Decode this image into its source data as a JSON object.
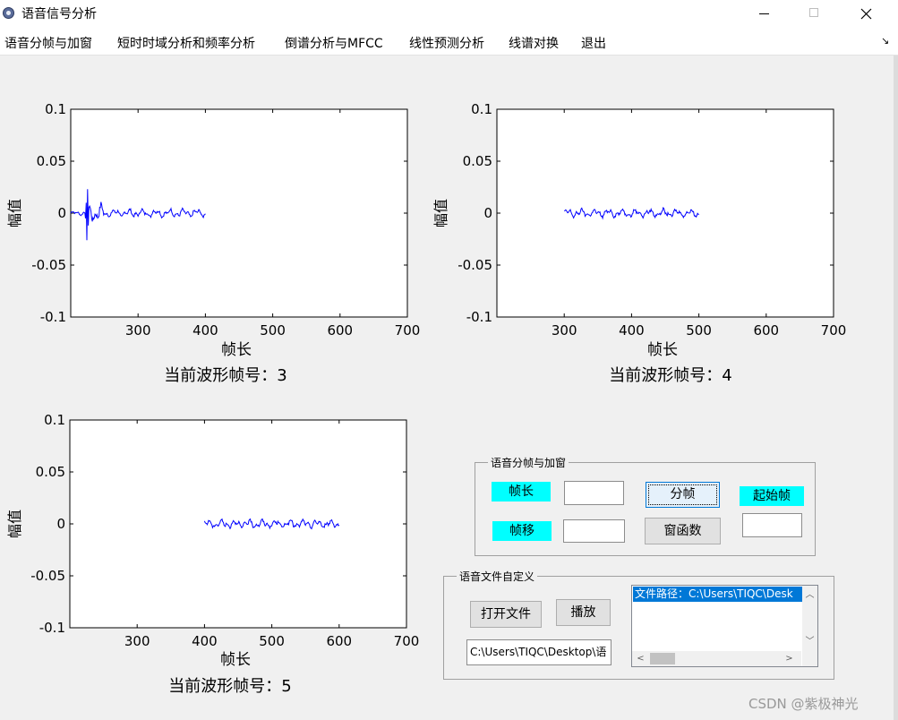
{
  "window": {
    "title": "语音信号分析",
    "minimize_icon": "minimize-icon",
    "maximize_icon": "maximize-icon",
    "close_icon": "close-icon"
  },
  "menu": {
    "items": [
      "语音分帧与加窗",
      "短时时域分析和频率分析",
      "倒谱分析与MFCC",
      "线性预测分析",
      "线谱对换",
      "退出"
    ],
    "corner_glyph": "↘"
  },
  "plots": [
    {
      "ylabel": "幅值",
      "xlabel": "帧长",
      "caption": "当前波形帧号：3",
      "yticks": [
        "0.1",
        "0.05",
        "0",
        "-0.05",
        "-0.1"
      ],
      "xticks": [
        "300",
        "400",
        "500",
        "600",
        "700"
      ]
    },
    {
      "ylabel": "幅值",
      "xlabel": "帧长",
      "caption": "当前波形帧号：4",
      "yticks": [
        "0.1",
        "0.05",
        "0",
        "-0.05",
        "-0.1"
      ],
      "xticks": [
        "300",
        "400",
        "500",
        "600",
        "700"
      ]
    },
    {
      "ylabel": "幅值",
      "xlabel": "帧长",
      "caption": "当前波形帧号：5",
      "yticks": [
        "0.1",
        "0.05",
        "0",
        "-0.05",
        "-0.1"
      ],
      "xticks": [
        "300",
        "400",
        "500",
        "600",
        "700"
      ]
    }
  ],
  "chart_data": [
    {
      "type": "line",
      "xlim": [
        200,
        700
      ],
      "ylim": [
        -0.1,
        0.1
      ],
      "x_range": [
        200,
        400
      ],
      "frame": 3,
      "color": "#0000ff"
    },
    {
      "type": "line",
      "xlim": [
        200,
        700
      ],
      "ylim": [
        -0.1,
        0.1
      ],
      "x_range": [
        300,
        500
      ],
      "frame": 4,
      "color": "#0000ff"
    },
    {
      "type": "line",
      "xlim": [
        200,
        700
      ],
      "ylim": [
        -0.1,
        0.1
      ],
      "x_range": [
        400,
        600
      ],
      "frame": 5,
      "color": "#0000ff"
    }
  ],
  "frame_panel": {
    "title": "语音分帧与加窗",
    "frame_length_label": "帧长",
    "frame_shift_label": "帧移",
    "start_frame_label": "起始帧",
    "frame_length_value": "",
    "frame_shift_value": "",
    "start_frame_value": "",
    "split_button": "分帧",
    "window_button": "窗函数",
    "label_color": "#00ffff"
  },
  "file_panel": {
    "title": "语音文件自定义",
    "open_button": "打开文件",
    "play_button": "播放",
    "path_value": "C:\\Users\\TIQC\\Desktop\\语",
    "list_items": [
      "文件路径：C:\\Users\\TIQC\\Desk"
    ]
  },
  "watermark": "CSDN @紫极神光"
}
